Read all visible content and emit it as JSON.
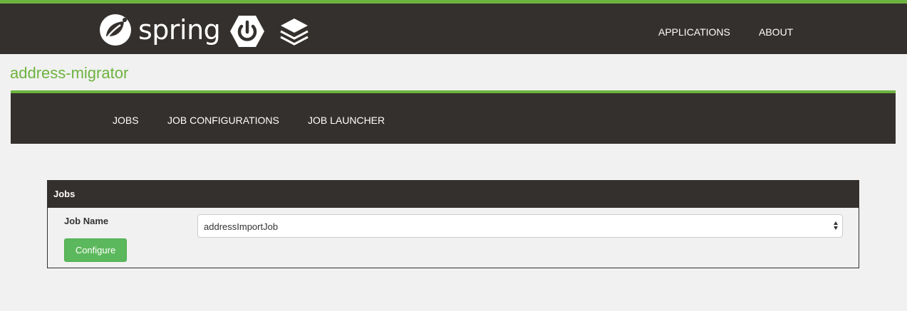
{
  "header": {
    "brand": "spring",
    "nav": [
      {
        "label": "APPLICATIONS"
      },
      {
        "label": "ABOUT"
      }
    ],
    "colors": {
      "background": "#34302d",
      "accent": "#6db33f"
    }
  },
  "page": {
    "title": "address-migrator"
  },
  "subnav": {
    "items": [
      {
        "label": "JOBS"
      },
      {
        "label": "JOB CONFIGURATIONS"
      },
      {
        "label": "JOB LAUNCHER"
      }
    ]
  },
  "panel": {
    "heading": "Jobs",
    "field_label": "Job Name",
    "select_value": "addressImportJob",
    "button_label": "Configure",
    "button_color": "#5cb85c"
  },
  "icons": [
    "spring-leaf-icon",
    "spring-boot-power-icon",
    "layers-stack-icon",
    "select-arrows-icon"
  ]
}
